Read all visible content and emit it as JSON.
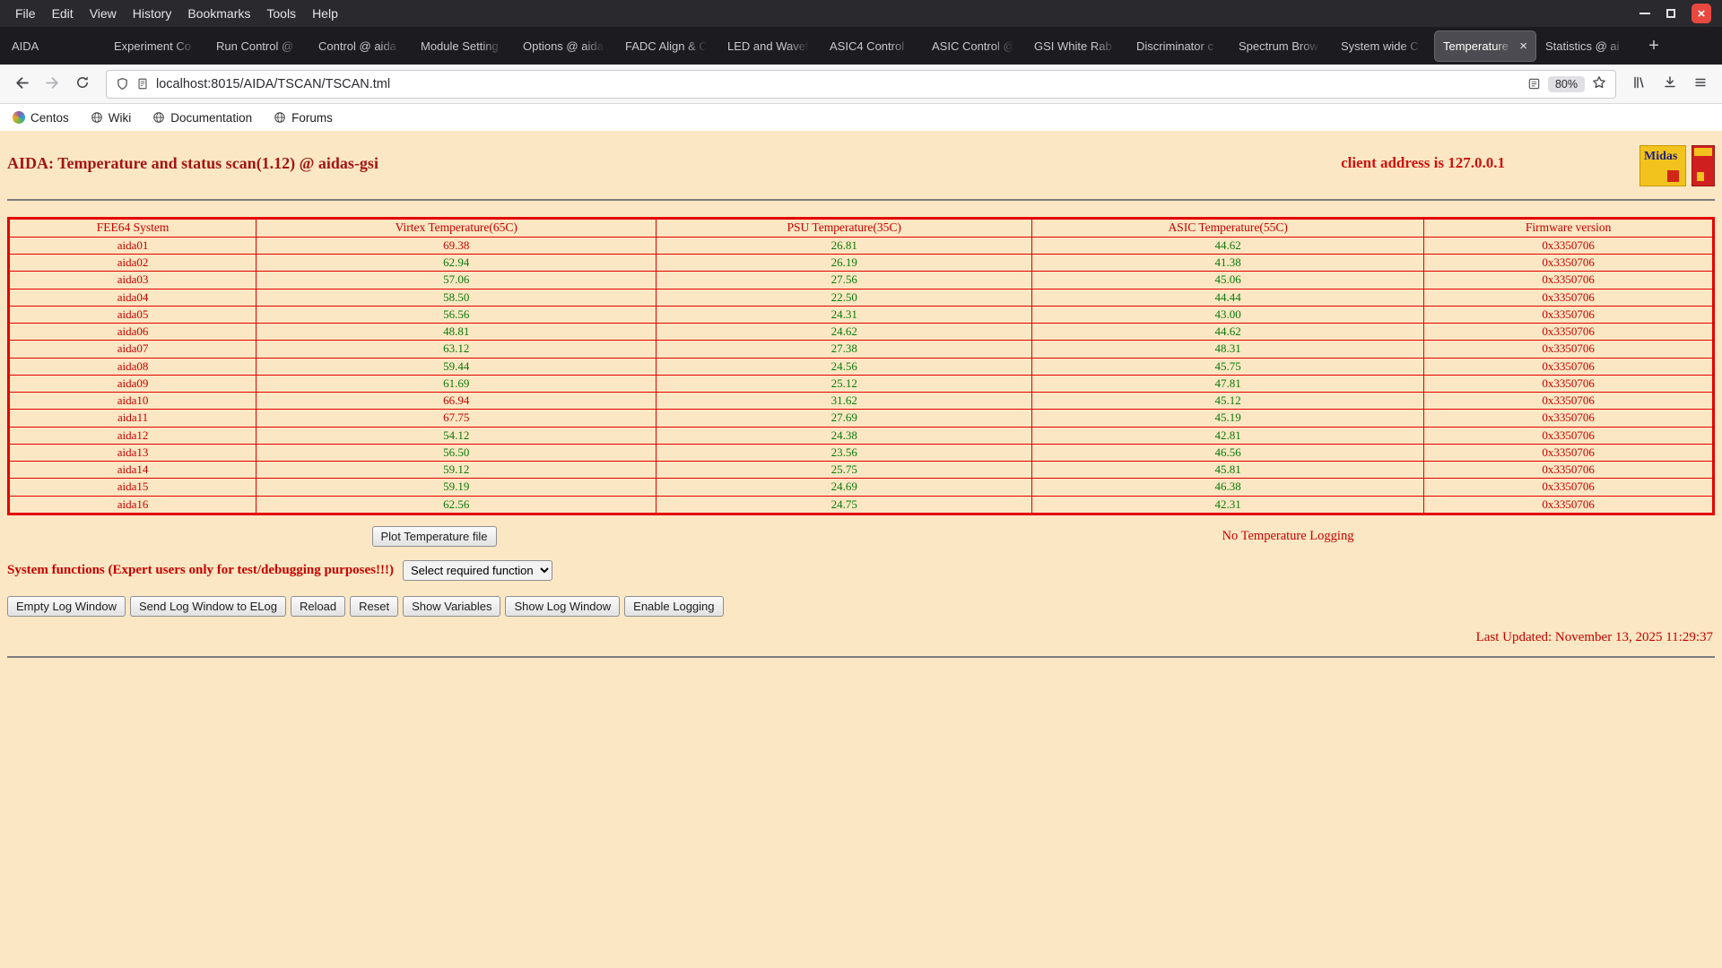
{
  "colors": {
    "page_background": "#fbe7c3",
    "alert_red": "#c60000",
    "ok_green": "#0a7a0a",
    "table_border_red": "#e30000"
  },
  "browser": {
    "menu_items": [
      "File",
      "Edit",
      "View",
      "History",
      "Bookmarks",
      "Tools",
      "Help"
    ],
    "tabs": [
      {
        "label": "AIDA",
        "active": false
      },
      {
        "label": "Experiment Co",
        "active": false
      },
      {
        "label": "Run Control @",
        "active": false
      },
      {
        "label": "Control @ aida",
        "active": false
      },
      {
        "label": "Module Setting",
        "active": false
      },
      {
        "label": "Options @ aida",
        "active": false
      },
      {
        "label": "FADC Align & C",
        "active": false
      },
      {
        "label": "LED and Wavef",
        "active": false
      },
      {
        "label": "ASIC4 Control",
        "active": false
      },
      {
        "label": "ASIC Control @",
        "active": false
      },
      {
        "label": "GSI White Rab",
        "active": false
      },
      {
        "label": "Discriminator c",
        "active": false
      },
      {
        "label": "Spectrum Brow",
        "active": false
      },
      {
        "label": "System wide C",
        "active": false
      },
      {
        "label": "Temperature",
        "active": true
      },
      {
        "label": "Statistics @ ai",
        "active": false
      }
    ],
    "close_tab_label": "×",
    "new_tab_label": "+",
    "url": "localhost:8015/AIDA/TSCAN/TSCAN.tml",
    "zoom_level": "80%",
    "bookmarks": [
      "Centos",
      "Wiki",
      "Documentation",
      "Forums"
    ]
  },
  "page": {
    "title": "AIDA: Temperature and status scan(1.12) @ aidas-gsi",
    "client_address": "client address is 127.0.0.1",
    "logos": {
      "midas_text": "Midas"
    },
    "table": {
      "headers": [
        "FEE64 System",
        "Virtex Temperature(65C)",
        "PSU Temperature(35C)",
        "ASIC Temperature(55C)",
        "Firmware version"
      ],
      "thresholds": {
        "virtex": 65,
        "psu": 35,
        "asic": 55
      },
      "rows": [
        {
          "system": "aida01",
          "virtex": "69.38",
          "psu": "26.81",
          "asic": "44.62",
          "firmware": "0x3350706"
        },
        {
          "system": "aida02",
          "virtex": "62.94",
          "psu": "26.19",
          "asic": "41.38",
          "firmware": "0x3350706"
        },
        {
          "system": "aida03",
          "virtex": "57.06",
          "psu": "27.56",
          "asic": "45.06",
          "firmware": "0x3350706"
        },
        {
          "system": "aida04",
          "virtex": "58.50",
          "psu": "22.50",
          "asic": "44.44",
          "firmware": "0x3350706"
        },
        {
          "system": "aida05",
          "virtex": "56.56",
          "psu": "24.31",
          "asic": "43.00",
          "firmware": "0x3350706"
        },
        {
          "system": "aida06",
          "virtex": "48.81",
          "psu": "24.62",
          "asic": "44.62",
          "firmware": "0x3350706"
        },
        {
          "system": "aida07",
          "virtex": "63.12",
          "psu": "27.38",
          "asic": "48.31",
          "firmware": "0x3350706"
        },
        {
          "system": "aida08",
          "virtex": "59.44",
          "psu": "24.56",
          "asic": "45.75",
          "firmware": "0x3350706"
        },
        {
          "system": "aida09",
          "virtex": "61.69",
          "psu": "25.12",
          "asic": "47.81",
          "firmware": "0x3350706"
        },
        {
          "system": "aida10",
          "virtex": "66.94",
          "psu": "31.62",
          "asic": "45.12",
          "firmware": "0x3350706"
        },
        {
          "system": "aida11",
          "virtex": "67.75",
          "psu": "27.69",
          "asic": "45.19",
          "firmware": "0x3350706"
        },
        {
          "system": "aida12",
          "virtex": "54.12",
          "psu": "24.38",
          "asic": "42.81",
          "firmware": "0x3350706"
        },
        {
          "system": "aida13",
          "virtex": "56.50",
          "psu": "23.56",
          "asic": "46.56",
          "firmware": "0x3350706"
        },
        {
          "system": "aida14",
          "virtex": "59.12",
          "psu": "25.75",
          "asic": "45.81",
          "firmware": "0x3350706"
        },
        {
          "system": "aida15",
          "virtex": "59.19",
          "psu": "24.69",
          "asic": "46.38",
          "firmware": "0x3350706"
        },
        {
          "system": "aida16",
          "virtex": "62.56",
          "psu": "24.75",
          "asic": "42.31",
          "firmware": "0x3350706"
        }
      ]
    },
    "plot_button_label": "Plot Temperature file",
    "logging_status": "No Temperature Logging",
    "system_functions_label": "System functions (Expert users only for test/debugging purposes!!!)",
    "select_placeholder": "Select required function",
    "action_buttons": [
      "Empty Log Window",
      "Send Log Window to ELog",
      "Reload",
      "Reset",
      "Show Variables",
      "Show Log Window",
      "Enable Logging"
    ],
    "last_updated": "Last Updated: November 13, 2025 11:29:37"
  }
}
